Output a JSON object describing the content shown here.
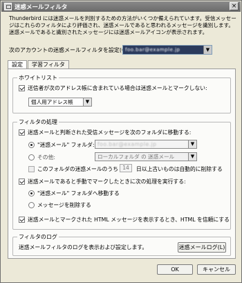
{
  "window": {
    "title": "迷惑メールフィルタ",
    "close_glyph": "×"
  },
  "description": "Thunderbird には迷惑メールを判別するための方法がいくつか備えられています。受信メッセージはこれらのフィルタにより評価され、迷惑メールであると思われるメッセージを識別します。迷惑メールであると識別されたメッセージには迷惑メールアイコンが表示されます。",
  "account": {
    "label": "次のアカウントの迷惑メールフィルタを設定(C):",
    "value": "foo.bar@example.jp"
  },
  "tabs": [
    {
      "label": "設定",
      "active": true
    },
    {
      "label": "学習フィルタ",
      "active": false
    }
  ],
  "whitelist": {
    "title": "ホワイトリスト",
    "checkbox_label": "送信者が次のアドレス帳に含まれている場合は迷惑メールとマークしない:",
    "addressbook_value": "個人用アドレス帳"
  },
  "filter_action": {
    "title": "フィルタの処理",
    "move_label": "迷惑メールと判断された受信メッセージを次のフォルダに移動する:",
    "junk_folder_label": "\"迷惑メール\" フォルダ:",
    "junk_folder_value": "foo.bar@example.jp",
    "other_label": "その他:",
    "other_value": "ローカルフォルダ の 迷惑メール",
    "purge_prefix": "このフォルダの迷惑メールのうち",
    "purge_days": "14",
    "purge_suffix": "日以上古いものは自動的に削除する",
    "manual_label": "迷惑メールであると手動でマークしたときに次の処理を実行する:",
    "move_to_junk_label": "\"迷惑メール\" フォルダへ移動する",
    "delete_label": "メッセージを削除する",
    "html_label": "迷惑メールとマークされた HTML メッセージを表示するとき、HTML を信頼にする"
  },
  "log": {
    "title": "フィルタのログ",
    "text": "迷惑メールフィルタのログを表示および設定します。",
    "button": "迷惑メールログ(L)"
  },
  "buttons": {
    "ok": "OK",
    "cancel": "キャンセル"
  },
  "icons": {
    "dropdown": "▼"
  }
}
